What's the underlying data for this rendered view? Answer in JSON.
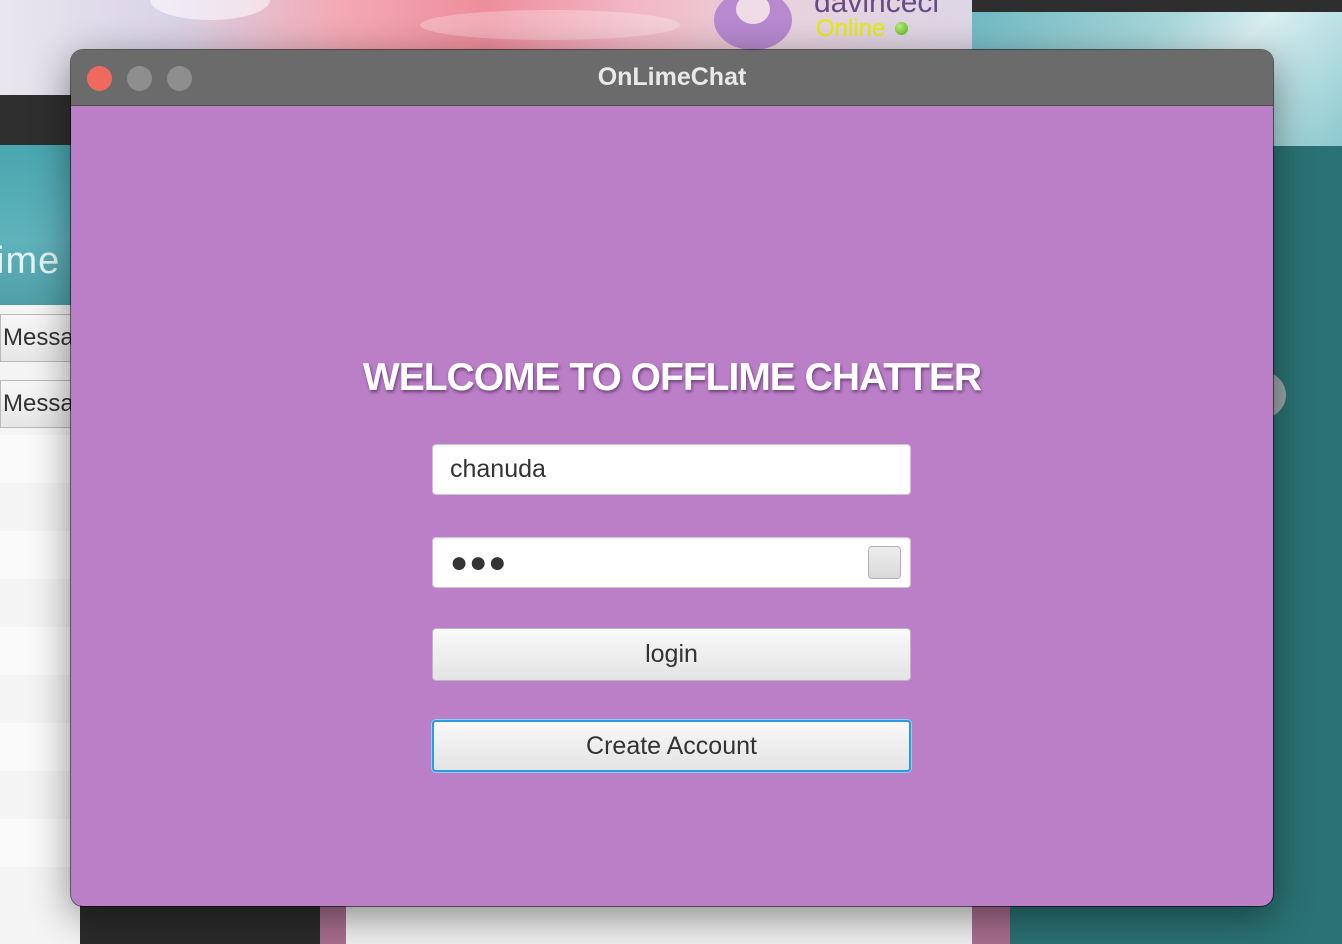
{
  "background": {
    "chat_user_status": "Online",
    "left_panel_title_fragment": "ime",
    "left_panel_buttons": [
      "Messa",
      "Messa"
    ]
  },
  "window": {
    "title": "OnLimeChat",
    "background_color": "#bb7fc8",
    "controls": [
      "close",
      "minimize",
      "maximize"
    ]
  },
  "login_form": {
    "heading": "WELCOME TO OFFLIME CHATTER",
    "username_value": "chanuda",
    "password_masked": "●●●",
    "login_label": "login",
    "create_account_label": "Create Account"
  },
  "colors": {
    "close_button": "#ee6a5e",
    "focus_ring": "#2a9bdf",
    "status_online": "#e7ec00"
  }
}
